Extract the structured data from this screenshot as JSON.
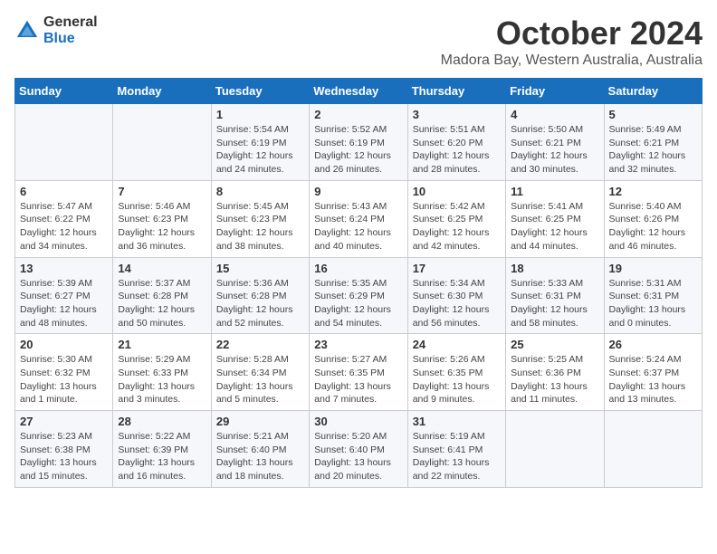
{
  "logo": {
    "general": "General",
    "blue": "Blue"
  },
  "header": {
    "month": "October 2024",
    "location": "Madora Bay, Western Australia, Australia"
  },
  "weekdays": [
    "Sunday",
    "Monday",
    "Tuesday",
    "Wednesday",
    "Thursday",
    "Friday",
    "Saturday"
  ],
  "weeks": [
    [
      {
        "day": "",
        "info": ""
      },
      {
        "day": "",
        "info": ""
      },
      {
        "day": "1",
        "info": "Sunrise: 5:54 AM\nSunset: 6:19 PM\nDaylight: 12 hours\nand 24 minutes."
      },
      {
        "day": "2",
        "info": "Sunrise: 5:52 AM\nSunset: 6:19 PM\nDaylight: 12 hours\nand 26 minutes."
      },
      {
        "day": "3",
        "info": "Sunrise: 5:51 AM\nSunset: 6:20 PM\nDaylight: 12 hours\nand 28 minutes."
      },
      {
        "day": "4",
        "info": "Sunrise: 5:50 AM\nSunset: 6:21 PM\nDaylight: 12 hours\nand 30 minutes."
      },
      {
        "day": "5",
        "info": "Sunrise: 5:49 AM\nSunset: 6:21 PM\nDaylight: 12 hours\nand 32 minutes."
      }
    ],
    [
      {
        "day": "6",
        "info": "Sunrise: 5:47 AM\nSunset: 6:22 PM\nDaylight: 12 hours\nand 34 minutes."
      },
      {
        "day": "7",
        "info": "Sunrise: 5:46 AM\nSunset: 6:23 PM\nDaylight: 12 hours\nand 36 minutes."
      },
      {
        "day": "8",
        "info": "Sunrise: 5:45 AM\nSunset: 6:23 PM\nDaylight: 12 hours\nand 38 minutes."
      },
      {
        "day": "9",
        "info": "Sunrise: 5:43 AM\nSunset: 6:24 PM\nDaylight: 12 hours\nand 40 minutes."
      },
      {
        "day": "10",
        "info": "Sunrise: 5:42 AM\nSunset: 6:25 PM\nDaylight: 12 hours\nand 42 minutes."
      },
      {
        "day": "11",
        "info": "Sunrise: 5:41 AM\nSunset: 6:25 PM\nDaylight: 12 hours\nand 44 minutes."
      },
      {
        "day": "12",
        "info": "Sunrise: 5:40 AM\nSunset: 6:26 PM\nDaylight: 12 hours\nand 46 minutes."
      }
    ],
    [
      {
        "day": "13",
        "info": "Sunrise: 5:39 AM\nSunset: 6:27 PM\nDaylight: 12 hours\nand 48 minutes."
      },
      {
        "day": "14",
        "info": "Sunrise: 5:37 AM\nSunset: 6:28 PM\nDaylight: 12 hours\nand 50 minutes."
      },
      {
        "day": "15",
        "info": "Sunrise: 5:36 AM\nSunset: 6:28 PM\nDaylight: 12 hours\nand 52 minutes."
      },
      {
        "day": "16",
        "info": "Sunrise: 5:35 AM\nSunset: 6:29 PM\nDaylight: 12 hours\nand 54 minutes."
      },
      {
        "day": "17",
        "info": "Sunrise: 5:34 AM\nSunset: 6:30 PM\nDaylight: 12 hours\nand 56 minutes."
      },
      {
        "day": "18",
        "info": "Sunrise: 5:33 AM\nSunset: 6:31 PM\nDaylight: 12 hours\nand 58 minutes."
      },
      {
        "day": "19",
        "info": "Sunrise: 5:31 AM\nSunset: 6:31 PM\nDaylight: 13 hours\nand 0 minutes."
      }
    ],
    [
      {
        "day": "20",
        "info": "Sunrise: 5:30 AM\nSunset: 6:32 PM\nDaylight: 13 hours\nand 1 minute."
      },
      {
        "day": "21",
        "info": "Sunrise: 5:29 AM\nSunset: 6:33 PM\nDaylight: 13 hours\nand 3 minutes."
      },
      {
        "day": "22",
        "info": "Sunrise: 5:28 AM\nSunset: 6:34 PM\nDaylight: 13 hours\nand 5 minutes."
      },
      {
        "day": "23",
        "info": "Sunrise: 5:27 AM\nSunset: 6:35 PM\nDaylight: 13 hours\nand 7 minutes."
      },
      {
        "day": "24",
        "info": "Sunrise: 5:26 AM\nSunset: 6:35 PM\nDaylight: 13 hours\nand 9 minutes."
      },
      {
        "day": "25",
        "info": "Sunrise: 5:25 AM\nSunset: 6:36 PM\nDaylight: 13 hours\nand 11 minutes."
      },
      {
        "day": "26",
        "info": "Sunrise: 5:24 AM\nSunset: 6:37 PM\nDaylight: 13 hours\nand 13 minutes."
      }
    ],
    [
      {
        "day": "27",
        "info": "Sunrise: 5:23 AM\nSunset: 6:38 PM\nDaylight: 13 hours\nand 15 minutes."
      },
      {
        "day": "28",
        "info": "Sunrise: 5:22 AM\nSunset: 6:39 PM\nDaylight: 13 hours\nand 16 minutes."
      },
      {
        "day": "29",
        "info": "Sunrise: 5:21 AM\nSunset: 6:40 PM\nDaylight: 13 hours\nand 18 minutes."
      },
      {
        "day": "30",
        "info": "Sunrise: 5:20 AM\nSunset: 6:40 PM\nDaylight: 13 hours\nand 20 minutes."
      },
      {
        "day": "31",
        "info": "Sunrise: 5:19 AM\nSunset: 6:41 PM\nDaylight: 13 hours\nand 22 minutes."
      },
      {
        "day": "",
        "info": ""
      },
      {
        "day": "",
        "info": ""
      }
    ]
  ]
}
